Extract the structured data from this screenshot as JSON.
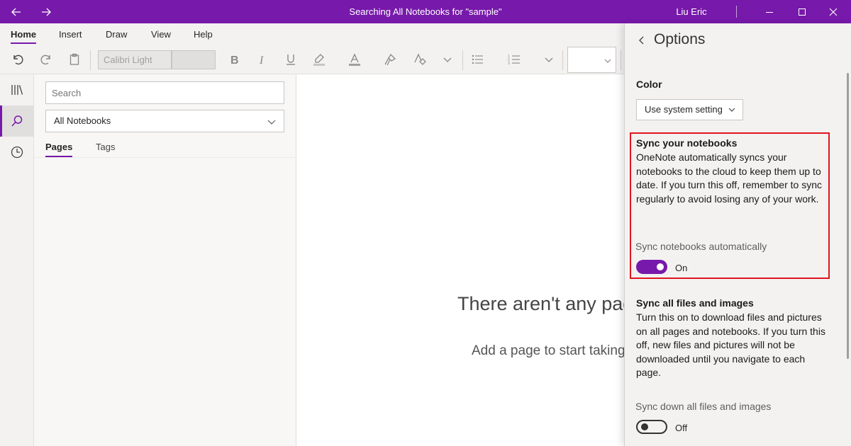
{
  "window": {
    "title": "Searching All Notebooks for \"sample\"",
    "user": "Liu Eric",
    "accent": "#7719aa"
  },
  "ribbon": {
    "tabs": [
      {
        "label": "Home",
        "active": true
      },
      {
        "label": "Insert"
      },
      {
        "label": "Draw"
      },
      {
        "label": "View"
      },
      {
        "label": "Help"
      }
    ],
    "font_name": "Calibri Light",
    "icons": [
      "undo-icon",
      "redo-icon",
      "clipboard-icon",
      "bold-icon",
      "italic-icon",
      "underline-icon",
      "highlighter-icon",
      "font-color-icon",
      "format-painter-icon",
      "clear-formatting-icon",
      "chevron-down-icon",
      "bullets-icon",
      "numbering-icon",
      "chevron-down-icon"
    ]
  },
  "nav_rail": {
    "items": [
      "notebooks-icon",
      "search-icon",
      "recent-icon"
    ],
    "active": "search-icon"
  },
  "search_pane": {
    "placeholder": "Search",
    "scope": "All Notebooks",
    "tabs": [
      "Pages",
      "Tags"
    ]
  },
  "canvas": {
    "empty_title": "There aren't any pages",
    "empty_sub": "Add a page to start taking notes"
  },
  "options": {
    "title": "Options",
    "color_heading": "Color",
    "color_value": "Use system setting",
    "sync_heading": "Sync your notebooks",
    "sync_desc": "OneNote automatically syncs your notebooks to the cloud to keep them up to date. If you turn this off, remember to sync regularly to avoid losing any of your work.",
    "sync_toggle_label": "Sync notebooks automatically",
    "sync_toggle_state": "On",
    "files_heading": "Sync all files and images",
    "files_desc": "Turn this on to download files and pictures on all pages and notebooks. If you turn this off, new files and pictures will not be downloaded until you navigate to each page.",
    "files_toggle_label": "Sync down all files and images",
    "files_toggle_state": "Off",
    "highlight_color": "#e0141e"
  }
}
